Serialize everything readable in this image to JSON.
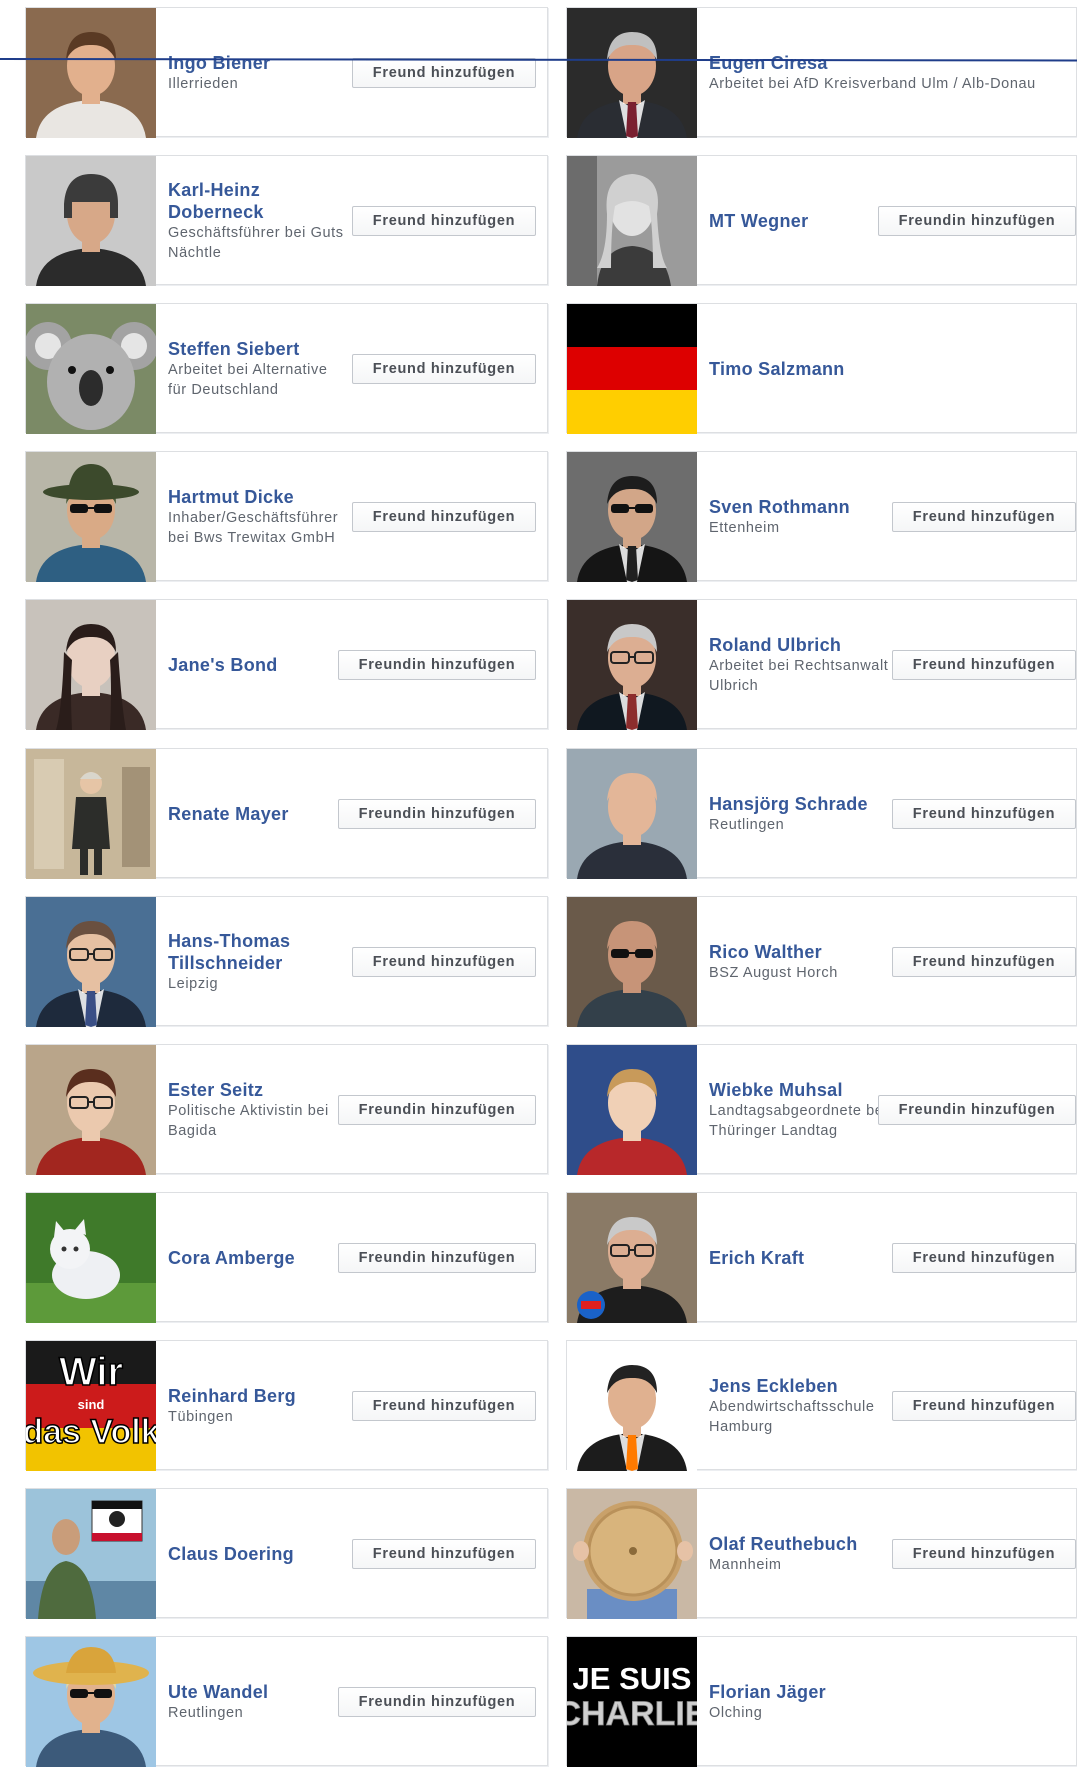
{
  "columns": [
    [
      {
        "name": "Ingo Biener",
        "sub": "Illerrieden",
        "button": "Freund hinzufügen",
        "photo": "man-smiling-icon"
      },
      {
        "name": "Karl-Heinz Doberneck",
        "sub": "Geschäftsführer bei Guts Nächtle",
        "button": "Freund hinzufügen",
        "photo": "man-winter-hat-icon"
      },
      {
        "name": "Steffen Siebert",
        "sub": "Arbeitet bei Alternative für Deutschland",
        "button": "Freund hinzufügen",
        "photo": "koala-icon"
      },
      {
        "name": "Hartmut Dicke",
        "sub": "Inhaber/Geschäftsführer bei Bws Trewitax GmbH",
        "button": "Freund hinzufügen",
        "photo": "man-hat-sunglasses-icon"
      },
      {
        "name": "Jane's Bond",
        "sub": "",
        "button": "Freundin hinzufügen",
        "photo": "woman-portrait-icon"
      },
      {
        "name": "Renate Mayer",
        "sub": "",
        "button": "Freundin hinzufügen",
        "photo": "woman-in-room-icon"
      },
      {
        "name": "Hans-Thomas Tillschneider",
        "sub": "Leipzig",
        "button": "Freund hinzufügen",
        "photo": "man-glasses-suit-icon"
      },
      {
        "name": "Ester Seitz",
        "sub": "Politische Aktivistin bei Bagida",
        "button": "Freundin hinzufügen",
        "photo": "woman-glasses-icon"
      },
      {
        "name": "Cora Amberge",
        "sub": "",
        "button": "Freundin hinzufügen",
        "photo": "white-cat-icon"
      },
      {
        "name": "Reinhard Berg",
        "sub": "Tübingen",
        "button": "Freund hinzufügen",
        "photo": "flag-text-banner-icon",
        "photoText": [
          "Wir",
          "sind",
          "das Volk"
        ]
      },
      {
        "name": "Claus Doering",
        "sub": "",
        "button": "Freund hinzufügen",
        "photo": "man-with-flag-icon"
      },
      {
        "name": "Ute Wandel",
        "sub": "Reutlingen",
        "button": "Freundin hinzufügen",
        "photo": "woman-straw-hat-icon"
      }
    ],
    [
      {
        "name": "Eugen Ciresa",
        "sub": "Arbeitet bei AfD Kreisverband Ulm / Alb-Donau",
        "button": "",
        "photo": "older-man-icon"
      },
      {
        "name": "MT Wegner",
        "sub": "",
        "button": "Freundin hinzufügen",
        "photo": "woman-bw-icon"
      },
      {
        "name": "Timo Salzmann",
        "sub": "",
        "button": "",
        "photo": "german-flag-icon"
      },
      {
        "name": "Sven Rothmann",
        "sub": "Ettenheim",
        "button": "Freund hinzufügen",
        "photo": "man-sunglasses-suit-icon"
      },
      {
        "name": "Roland Ulbrich",
        "sub": "Arbeitet bei Rechtsanwalt Ulbrich",
        "button": "Freund hinzufügen",
        "photo": "man-glasses-grey-icon"
      },
      {
        "name": "Hansjörg Schrade",
        "sub": "Reutlingen",
        "button": "Freund hinzufügen",
        "photo": "bald-man-icon"
      },
      {
        "name": "Rico Walther",
        "sub": "BSZ August Horch",
        "button": "Freund hinzufügen",
        "photo": "man-sunglasses-icon"
      },
      {
        "name": "Wiebke Muhsal",
        "sub": "Landtagsabgeordnete bei Thüringer Landtag",
        "button": "Freundin hinzufügen",
        "photo": "young-woman-icon"
      },
      {
        "name": "Erich Kraft",
        "sub": "",
        "button": "Freund hinzufügen",
        "photo": "older-man-glasses-icon"
      },
      {
        "name": "Jens Eckleben",
        "sub": "Abendwirtschaftsschule Hamburg",
        "button": "Freund hinzufügen",
        "photo": "man-orange-tie-icon"
      },
      {
        "name": "Olaf Reuthebuch",
        "sub": "Mannheim",
        "button": "Freund hinzufügen",
        "photo": "child-with-bread-icon"
      },
      {
        "name": "Florian Jäger",
        "sub": "Olching",
        "button": "",
        "photo": "je-suis-charlie-icon",
        "photoText": [
          "JE SUIS",
          "CHARLIE"
        ]
      }
    ]
  ],
  "colors": {
    "link": "#365899",
    "text": "#5f656e",
    "border": "#dddfe2",
    "button_text": "#4b4f56",
    "scribble": "#1f3d8a"
  }
}
